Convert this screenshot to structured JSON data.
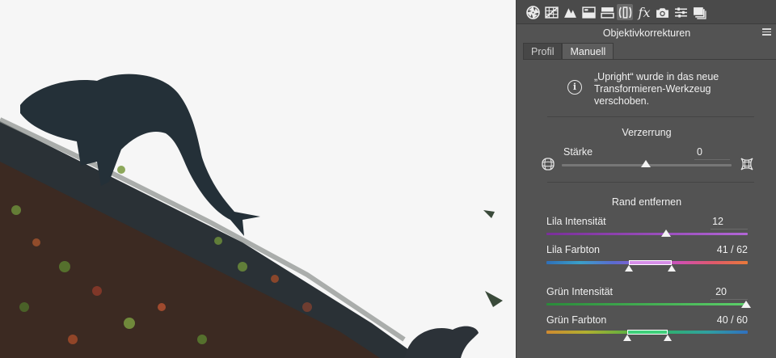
{
  "toolbar": {
    "icons": [
      "aperture-icon",
      "tone-curve-icon",
      "detail-icon",
      "hsl-icon",
      "split-toning-icon",
      "lens-corrections-icon",
      "effects-icon",
      "camera-calibration-icon",
      "presets-icon",
      "snapshots-icon"
    ],
    "fx_glyph": "fx"
  },
  "panel": {
    "title": "Objektivkorrekturen",
    "tabs": [
      {
        "label": "Profil",
        "active": false
      },
      {
        "label": "Manuell",
        "active": true
      }
    ],
    "info": {
      "glyph": "i",
      "lines": [
        "„Upright“ wurde in das neue",
        "Transformieren-Werkzeug",
        "verschoben."
      ]
    },
    "distortion": {
      "title": "Verzerrung",
      "strength_label": "Stärke",
      "strength_value": "0"
    },
    "defringe": {
      "title": "Rand entfernen",
      "purple_amount_label": "Lila Intensität",
      "purple_amount_value": "12",
      "purple_hue_label": "Lila Farbton",
      "purple_hue_value": "41 / 62",
      "green_amount_label": "Grün Intensität",
      "green_amount_value": "20",
      "green_hue_label": "Grün Farbton",
      "green_hue_value": "40 / 60"
    }
  },
  "colors": {
    "panel_bg": "#535353",
    "purple": "#8a3fa8",
    "green": "#3fb24f"
  }
}
